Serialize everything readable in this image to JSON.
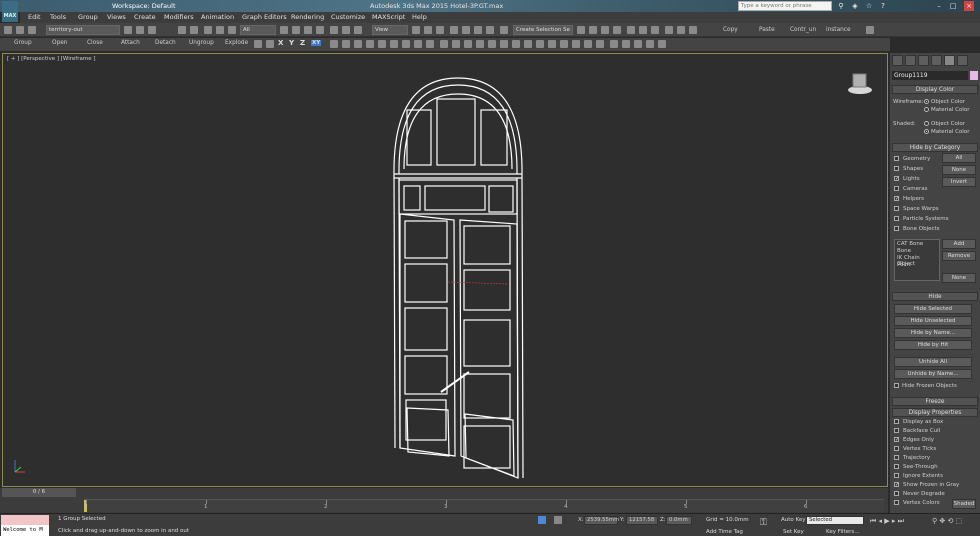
{
  "title_bar": {
    "workspace": "Workspace: Default",
    "app_title": "Autodesk 3ds Max 2015   Hotel-3P.GT.max",
    "search_placeholder": "Type a keyword or phrase",
    "logo_text": "MAX"
  },
  "menu": [
    "Edit",
    "Tools",
    "Group",
    "Views",
    "Create",
    "Modifiers",
    "Animation",
    "Graph Editors",
    "Rendering",
    "Customize",
    "MAXScript",
    "Help"
  ],
  "toolbar": {
    "layer_dropdown": "territory-out",
    "selection_filter": "All",
    "reference_coord": "View",
    "selection_set": "Create Selection Se",
    "right_buttons": [
      "Copy",
      "Paste",
      "Contr_un",
      "instance"
    ]
  },
  "toolbar2": {
    "buttons": [
      "Group",
      "Open",
      "Close",
      "Attach",
      "Detach",
      "Ungroup",
      "Explode"
    ],
    "axes": [
      "X",
      "Y",
      "Z",
      "XY"
    ]
  },
  "viewport": {
    "label": "[ + ] [Perspective ] [Wireframe ]"
  },
  "panel": {
    "object_name": "Group1119",
    "display_color": {
      "header": "Display Color",
      "wireframe_label": "Wireframe:",
      "shaded_label": "Shaded:",
      "object_color": "Object Color",
      "material_color": "Material Color"
    },
    "hide_by_category": {
      "header": "Hide by Category",
      "items": [
        {
          "label": "Geometry",
          "checked": false
        },
        {
          "label": "Shapes",
          "checked": false
        },
        {
          "label": "Lights",
          "checked": true
        },
        {
          "label": "Cameras",
          "checked": false
        },
        {
          "label": "Helpers",
          "checked": true
        },
        {
          "label": "Space Warps",
          "checked": false
        },
        {
          "label": "Particle Systems",
          "checked": false
        },
        {
          "label": "Bone Objects",
          "checked": false
        }
      ],
      "all_button": "All",
      "none_button": "None",
      "invert_button": "Invert",
      "list_items": [
        "CAT Bone",
        "Bone",
        "IK Chain Object",
        "Point"
      ],
      "add_button": "Add",
      "remove_button": "Remove",
      "none_button2": "None"
    },
    "hide": {
      "header": "Hide",
      "buttons": [
        "Hide Selected",
        "Hide Unselected",
        "Hide by Name...",
        "Hide by Hit",
        "Unhide All",
        "Unhide by Name..."
      ],
      "hide_frozen": "Hide Frozen Objects"
    },
    "freeze": {
      "header": "Freeze"
    },
    "display_properties": {
      "header": "Display Properties",
      "items": [
        {
          "label": "Display as Box",
          "checked": false
        },
        {
          "label": "Backface Cull",
          "checked": false
        },
        {
          "label": "Edges Only",
          "checked": true
        },
        {
          "label": "Vertex Ticks",
          "checked": false
        },
        {
          "label": "Trajectory",
          "checked": false
        },
        {
          "label": "See-Through",
          "checked": false
        },
        {
          "label": "Ignore Extents",
          "checked": false
        },
        {
          "label": "Show Frozen in Gray",
          "checked": true
        },
        {
          "label": "Never Degrade",
          "checked": false
        },
        {
          "label": "Vertex Colors",
          "checked": false
        }
      ],
      "shaded_button": "Shaded"
    }
  },
  "timeline": {
    "frame_counter": "0 / 6",
    "ticks": [
      "0",
      "1",
      "2",
      "3",
      "4",
      "5",
      "6"
    ]
  },
  "status": {
    "welcome": "Welcome to M",
    "selection": "1 Group Selected",
    "prompt": "Click and drag up-and-down to zoom in and out",
    "x_label": "X:",
    "x_value": "2539.55mm",
    "y_label": "Y:",
    "y_value": "12157.58",
    "z_label": "Z:",
    "z_value": "0.0mm",
    "grid": "Grid = 10.0mm",
    "add_time_tag": "Add Time Tag",
    "auto_key": "Auto Key",
    "set_key": "Set Key",
    "selected_dropdown": "Selected",
    "key_filters": "Key Filters..."
  },
  "colors": {
    "viewport_bg": "#2e2e2e",
    "wireframe": "#ffffff",
    "selection_frame": "#8c8c50"
  }
}
